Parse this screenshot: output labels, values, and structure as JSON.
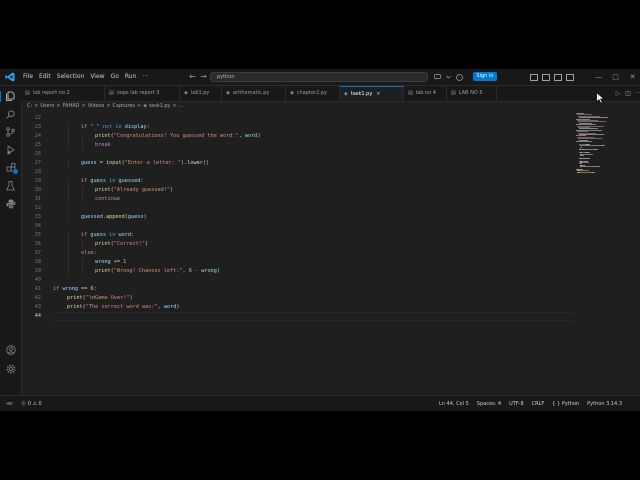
{
  "app": {
    "accent": "#0078d4"
  },
  "menu": [
    "File",
    "Edit",
    "Selection",
    "View",
    "Go",
    "Run",
    "···"
  ],
  "nav": {
    "back": "←",
    "forward": "→"
  },
  "command_center": {
    "text": "python"
  },
  "account": {
    "sign_in": "Sign In"
  },
  "window_controls": {
    "minimize": "—",
    "maximize": "□",
    "close": "✕"
  },
  "activity_bar": {
    "items": [
      {
        "icon": "explorer-icon"
      },
      {
        "icon": "search-icon"
      },
      {
        "icon": "source-control-icon"
      },
      {
        "icon": "run-debug-icon"
      },
      {
        "icon": "extensions-icon"
      },
      {
        "icon": "testing-icon"
      },
      {
        "icon": "python-icon"
      }
    ],
    "bottom": [
      {
        "icon": "account-icon"
      },
      {
        "icon": "settings-gear-icon"
      }
    ]
  },
  "tabs": [
    {
      "label": "lab report no 2",
      "icon": "file-icon",
      "icon_color": "#9d9d9d",
      "active": false
    },
    {
      "label": "oops lab report 3",
      "icon": "file-icon",
      "icon_color": "#9d9d9d",
      "active": false
    },
    {
      "label": "lab1.py",
      "icon": "python-file-icon",
      "icon_color": "#4b8bbe",
      "active": false
    },
    {
      "label": "arithematic.py",
      "icon": "python-file-icon",
      "icon_color": "#4b8bbe",
      "active": false
    },
    {
      "label": "chapter2.py",
      "icon": "python-file-icon",
      "icon_color": "#4b8bbe",
      "active": false
    },
    {
      "label": "task1.py",
      "icon": "python-file-icon",
      "icon_color": "#4b8bbe",
      "active": true,
      "close": "×"
    },
    {
      "label": "lab no 4",
      "icon": "file-icon",
      "icon_color": "#9d9d9d",
      "active": false
    },
    {
      "label": "LAB NO 5",
      "icon": "file-icon",
      "icon_color": "#9d9d9d",
      "active": false
    }
  ],
  "breadcrumb": [
    "C:",
    "Users",
    "FAHAD",
    "Videos",
    "Captures",
    "task1.py",
    "..."
  ],
  "editor": {
    "line_numbers": [
      "22",
      "23",
      "24",
      "25",
      "26",
      "27",
      "28",
      "29",
      "30",
      "31",
      "32",
      "33",
      "34",
      "35",
      "36",
      "37",
      "38",
      "39",
      "40",
      "41",
      "42",
      "43",
      "44"
    ],
    "current_line": "44",
    "lines": [
      [],
      [
        [
          "kw",
          "if "
        ],
        [
          "st",
          "\"_\""
        ],
        [
          "op",
          " "
        ],
        [
          "kb",
          "not in"
        ],
        [
          "op",
          " "
        ],
        [
          "vr",
          "display"
        ],
        [
          "op",
          ":"
        ]
      ],
      [
        [
          "fn",
          "print"
        ],
        [
          "op",
          "("
        ],
        [
          "st",
          "\"Congratulations! You guessed the word:\""
        ],
        [
          "op",
          ", "
        ],
        [
          "vr",
          "word"
        ],
        [
          "op",
          ")"
        ]
      ],
      [
        [
          "kw",
          "break"
        ]
      ],
      [],
      [
        [
          "vr",
          "guess"
        ],
        [
          "op",
          " = "
        ],
        [
          "fn",
          "input"
        ],
        [
          "op",
          "("
        ],
        [
          "st",
          "\"Enter a letter: \""
        ],
        [
          "op",
          ")."
        ],
        [
          "fn",
          "lower"
        ],
        [
          "op",
          "()"
        ]
      ],
      [],
      [
        [
          "kw",
          "if "
        ],
        [
          "vr",
          "guess"
        ],
        [
          "op",
          " "
        ],
        [
          "kb",
          "in"
        ],
        [
          "op",
          " "
        ],
        [
          "vr",
          "guessed"
        ],
        [
          "op",
          ":"
        ]
      ],
      [
        [
          "fn",
          "print"
        ],
        [
          "op",
          "("
        ],
        [
          "st",
          "\"Already guessed!\""
        ],
        [
          "op",
          ")"
        ]
      ],
      [
        [
          "kw",
          "continue"
        ]
      ],
      [],
      [
        [
          "vr",
          "guessed"
        ],
        [
          "op",
          "."
        ],
        [
          "fn",
          "append"
        ],
        [
          "op",
          "("
        ],
        [
          "vr",
          "guess"
        ],
        [
          "op",
          ")"
        ]
      ],
      [],
      [
        [
          "kw",
          "if "
        ],
        [
          "vr",
          "guess"
        ],
        [
          "op",
          " "
        ],
        [
          "kb",
          "in"
        ],
        [
          "op",
          " "
        ],
        [
          "vr",
          "word"
        ],
        [
          "op",
          ":"
        ]
      ],
      [
        [
          "fn",
          "print"
        ],
        [
          "op",
          "("
        ],
        [
          "st",
          "\"Correct!\""
        ],
        [
          "op",
          ")"
        ]
      ],
      [
        [
          "kw",
          "else"
        ],
        [
          "op",
          ":"
        ]
      ],
      [
        [
          "vr",
          "wrong"
        ],
        [
          "op",
          " += "
        ],
        [
          "nm",
          "1"
        ]
      ],
      [
        [
          "fn",
          "print"
        ],
        [
          "op",
          "("
        ],
        [
          "st",
          "\"Wrong! Chances left:\""
        ],
        [
          "op",
          ", "
        ],
        [
          "nm",
          "6"
        ],
        [
          "op",
          " - "
        ],
        [
          "vr",
          "wrong"
        ],
        [
          "op",
          ")"
        ]
      ],
      [],
      [
        [
          "kw",
          "if "
        ],
        [
          "vr",
          "wrong"
        ],
        [
          "op",
          " == "
        ],
        [
          "nm",
          "6"
        ],
        [
          "op",
          ":"
        ]
      ],
      [
        [
          "fn",
          "print"
        ],
        [
          "op",
          "("
        ],
        [
          "st",
          "\""
        ],
        [
          "es",
          "\\n"
        ],
        [
          "st",
          "Game Over!\""
        ],
        [
          "op",
          ")"
        ]
      ],
      [
        [
          "fn",
          "print"
        ],
        [
          "op",
          "("
        ],
        [
          "st",
          "\"The correct word was:\""
        ],
        [
          "op",
          ", "
        ],
        [
          "vr",
          "word"
        ],
        [
          "op",
          ")"
        ]
      ],
      []
    ],
    "indents": [
      0,
      2,
      3,
      3,
      0,
      2,
      0,
      2,
      3,
      3,
      0,
      2,
      0,
      2,
      3,
      2,
      3,
      3,
      0,
      0,
      1,
      1,
      1
    ]
  },
  "status_bar": {
    "remote_icon": "remote-icon",
    "problems": "ⓧ 0 ⚠ 0",
    "position": "Ln 44, Col 5",
    "spaces": "Spaces: 4",
    "encoding": "UTF-8",
    "eol": "CRLF",
    "language": "{ } Python",
    "interpreter": "Python 3.14.3"
  }
}
